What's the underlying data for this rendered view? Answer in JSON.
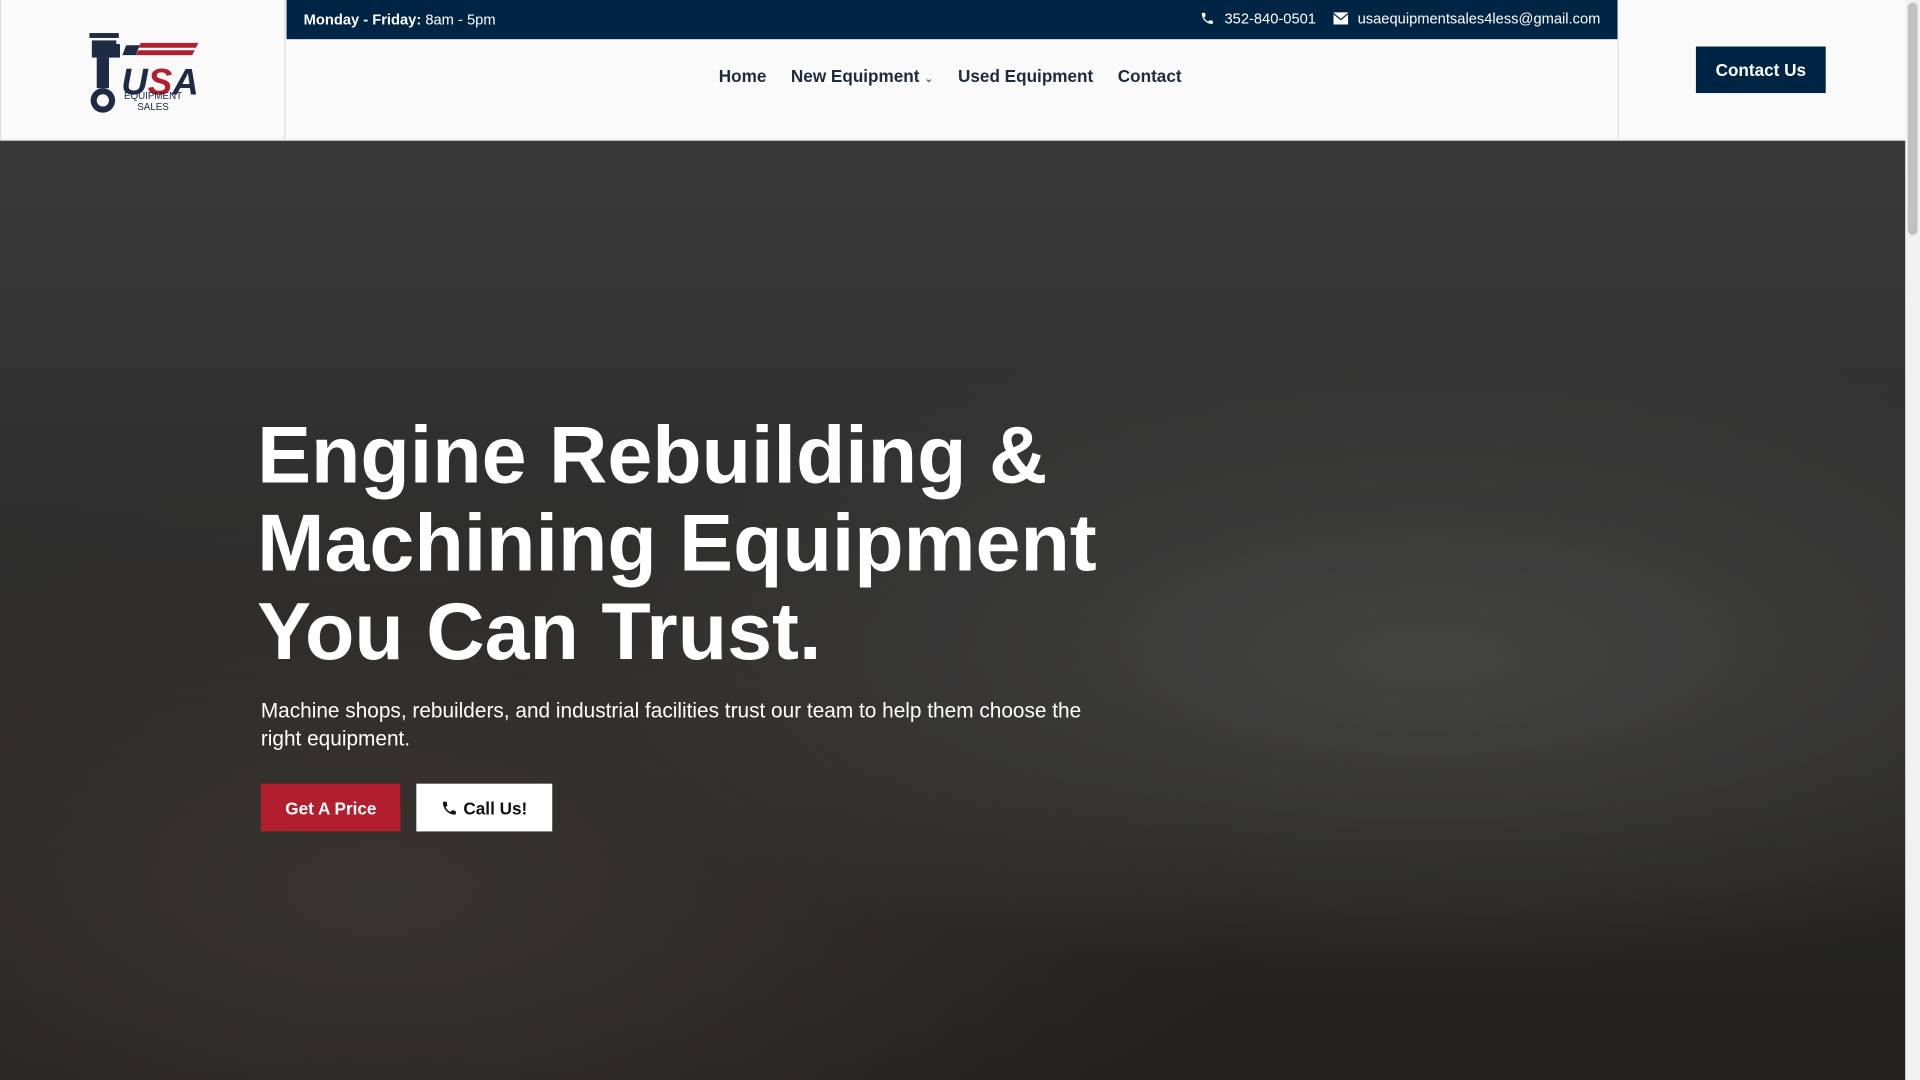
{
  "brand": {
    "logo_text": "USA",
    "logo_sub1": "EQUIPMENT",
    "logo_sub2": "SALES"
  },
  "topbar": {
    "hours_label": "Monday - Friday:",
    "hours_value": "8am - 5pm",
    "phone": "352-840-0501",
    "email": "usaequipmentsales4less@gmail.com"
  },
  "nav": {
    "items": [
      "Home",
      "New Equipment",
      "Used Equipment",
      "Contact"
    ]
  },
  "header": {
    "cta": "Contact Us"
  },
  "hero": {
    "title_line1": "Engine Rebuilding &",
    "title_line2": "Machining Equipment",
    "title_line3": "You Can Trust.",
    "subtitle": "Machine shops, rebuilders, and industrial facilities trust our team to help them choose the right equipment.",
    "primary_button": "Get A Price",
    "secondary_button": "Call Us!"
  },
  "colors": {
    "navy": "#002444",
    "red": "#b11e2e"
  }
}
